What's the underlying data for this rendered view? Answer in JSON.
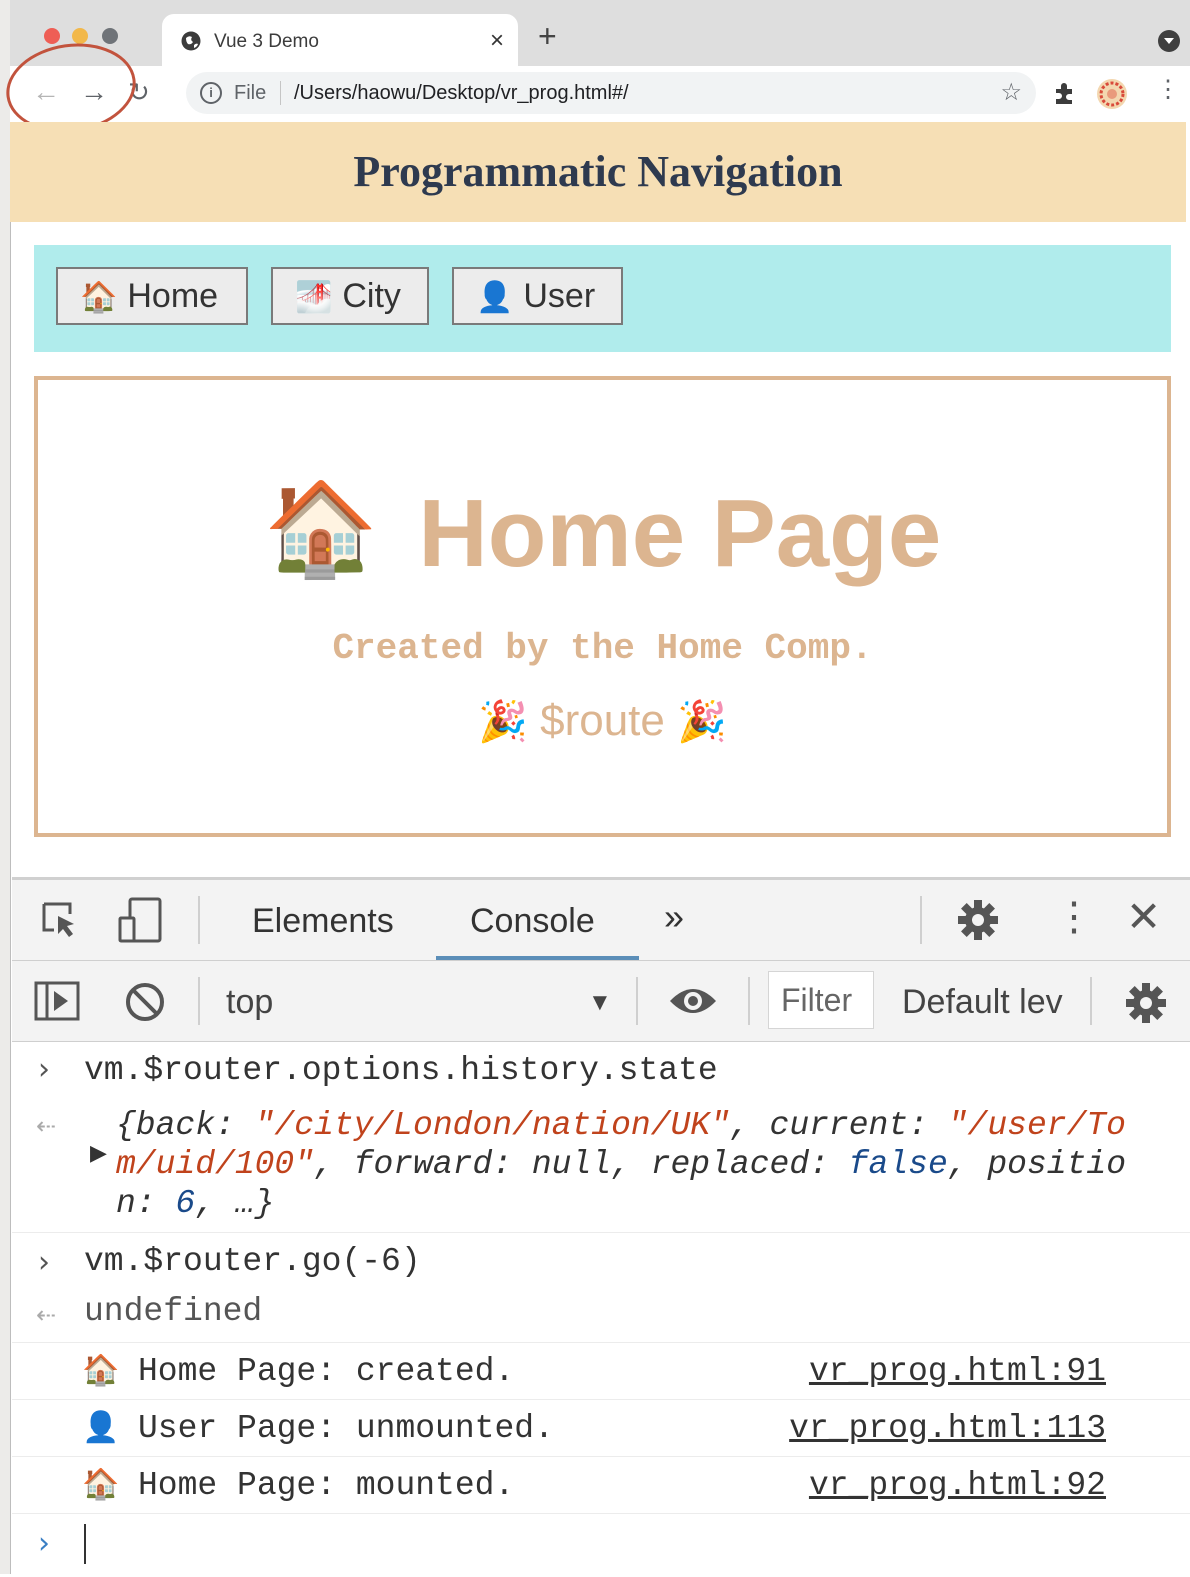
{
  "browser": {
    "tab_title": "Vue 3 Demo",
    "tab_close": "×",
    "new_tab": "+",
    "omnibox": {
      "scheme_label": "File",
      "url": "/Users/haowu/Desktop/vr_prog.html#/"
    },
    "traffic_colors": [
      "#ee5e55",
      "#f2b84a",
      "#6f7378"
    ]
  },
  "page": {
    "header_title": "Programmatic Navigation",
    "nav_buttons": [
      {
        "emoji": "🏠",
        "label": "Home"
      },
      {
        "emoji": "🌁",
        "label": "City"
      },
      {
        "emoji": "👤",
        "label": "User"
      }
    ],
    "content": {
      "emoji": "🏠",
      "title": "Home Page",
      "subtitle": "Created by the Home Comp.",
      "party_emoji": "🎉",
      "route_text": "$route"
    }
  },
  "devtools": {
    "tabs": [
      {
        "label": "Elements",
        "active": false
      },
      {
        "label": "Console",
        "active": true
      }
    ],
    "more_tabs": "»",
    "context": "top",
    "filter_placeholder": "Filter",
    "levels": "Default lev",
    "console": {
      "cmd1": "vm.$router.options.history.state",
      "obj_line1_a": "{back: ",
      "obj_line1_b": "\"/city/London/nation/UK\"",
      "obj_line1_c": ", current: ",
      "obj_line1_d": "\"/user/To",
      "obj_line2_a": "m/uid/100\"",
      "obj_line2_b": ", forward: null, replaced: ",
      "obj_line2_c": "false",
      "obj_line2_d": ", positio",
      "obj_line3_a": "n: ",
      "obj_line3_b": "6",
      "obj_line3_c": ", …}",
      "cmd2": "vm.$router.go(-6)",
      "result2": "undefined",
      "logs": [
        {
          "emoji": "🏠",
          "text": "Home Page: created.",
          "source": "vr_prog.html:91"
        },
        {
          "emoji": "👤",
          "text": "User Page: unmounted.",
          "source": "vr_prog.html:113"
        },
        {
          "emoji": "🏠",
          "text": "Home Page: mounted.",
          "source": "vr_prog.html:92"
        }
      ]
    }
  }
}
